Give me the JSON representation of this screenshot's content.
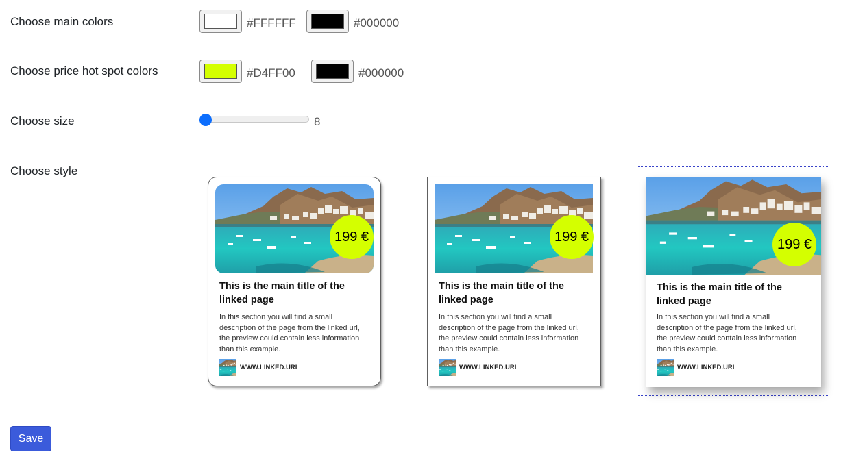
{
  "labels": {
    "main_colors": "Choose main colors",
    "price_colors": "Choose price hot spot colors",
    "size": "Choose size",
    "style": "Choose style"
  },
  "main_colors": {
    "primary": {
      "hex_label": "#FFFFFF",
      "value": "#FFFFFF"
    },
    "secondary": {
      "hex_label": "#000000",
      "value": "#000000"
    }
  },
  "price_colors": {
    "background": {
      "hex_label": "#D4FF00",
      "value": "#D4FF00"
    },
    "text": {
      "hex_label": "#000000",
      "value": "#000000"
    }
  },
  "size": {
    "value": "8",
    "min": 8,
    "max": 30,
    "accent": "#0d6efd"
  },
  "card": {
    "price": "199 €",
    "title": "This is the main title of the linked page",
    "description": "In this section you will find a small description of the page from the linked url, the preview could contain less information than this example.",
    "url": "WWW.LINKED.URL"
  },
  "styles": [
    {
      "name": "rounded",
      "selected": false
    },
    {
      "name": "square",
      "selected": false
    },
    {
      "name": "shadow",
      "selected": true
    }
  ],
  "save_label": "Save",
  "colors": {
    "save_button": "#3b5bdb",
    "selection_outline": "#3a44c9"
  }
}
